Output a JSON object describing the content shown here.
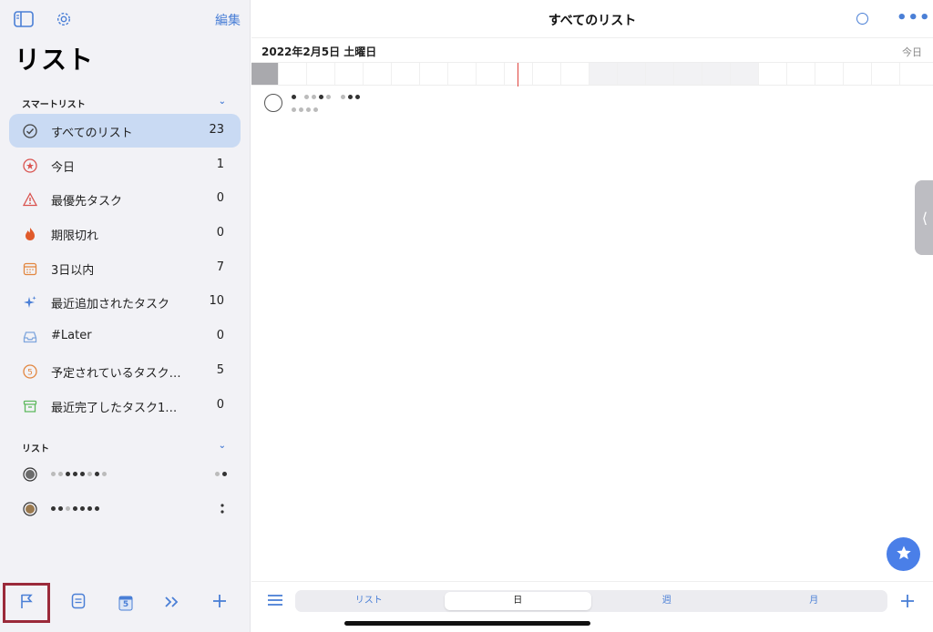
{
  "sidebar": {
    "edit_label": "編集",
    "title": "リスト",
    "smart_section": "スマートリスト",
    "lists_section": "リスト",
    "smart_items": [
      {
        "label": "すべてのリスト",
        "count": "23",
        "icon": "check-circle-icon"
      },
      {
        "label": "今日",
        "count": "1",
        "icon": "star-circle-icon"
      },
      {
        "label": "最優先タスク",
        "count": "0",
        "icon": "warning-triangle-icon"
      },
      {
        "label": "期限切れ",
        "count": "0",
        "icon": "flame-icon"
      },
      {
        "label": "3日以内",
        "count": "7",
        "icon": "calendar-icon"
      },
      {
        "label": "最近追加されたタスク",
        "count": "10",
        "icon": "sparkle-icon"
      },
      {
        "label": "#Later",
        "count": "0",
        "icon": "inbox-icon"
      },
      {
        "label": "予定されているタスク…",
        "count": "5",
        "icon": "scheduled-circle-icon"
      },
      {
        "label": "最近完了したタスク1…",
        "count": "0",
        "icon": "archive-icon"
      }
    ],
    "bottom_toolbar": [
      "flag-icon",
      "note-icon",
      "calendar-5-icon",
      "chevrons-right-icon",
      "plus-icon"
    ],
    "calendar_badge": "5"
  },
  "main": {
    "title": "すべてのリスト",
    "date": "2022年2月5日 土曜日",
    "today_link": "今日",
    "view_tabs": [
      "リスト",
      "日",
      "週",
      "月"
    ],
    "active_tab": "日",
    "edge_chevron": "⟨"
  },
  "colors": {
    "accent": "#4a7fd6",
    "selected_bg": "#c9daf3",
    "highlight_box": "#9b2a3a",
    "now_line": "#e0443e"
  }
}
